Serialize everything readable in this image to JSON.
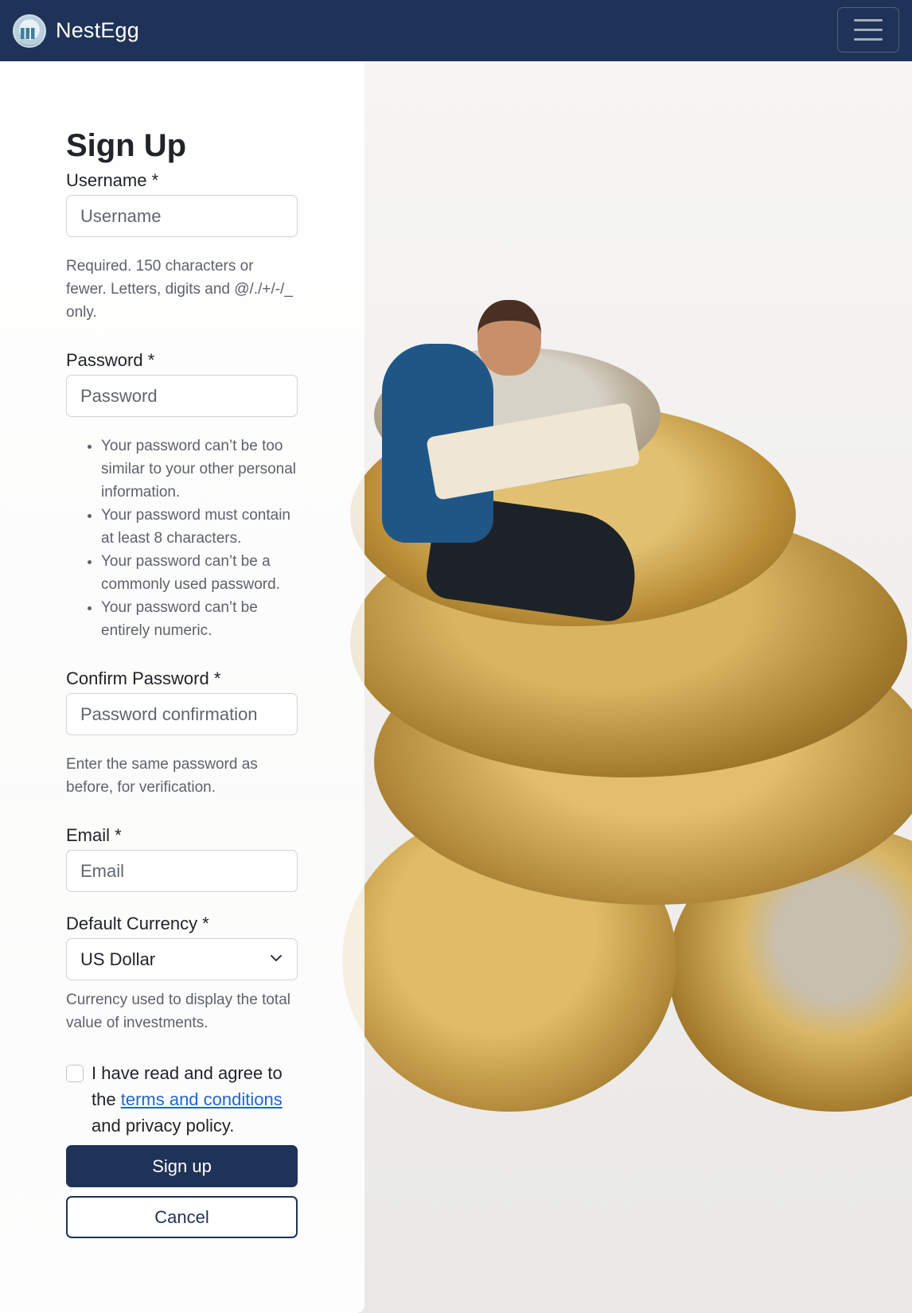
{
  "navbar": {
    "brand_name": "NestEgg",
    "logo_icon": "nest-egg-logo-icon",
    "menu_icon": "hamburger-menu-icon"
  },
  "form": {
    "title": "Sign Up",
    "username": {
      "label": "Username *",
      "placeholder": "Username",
      "help": "Required. 150 characters or fewer. Letters, digits and @/./+/-/_ only."
    },
    "password": {
      "label": "Password *",
      "placeholder": "Password",
      "rules": [
        "Your password can’t be too similar to your other personal information.",
        "Your password must contain at least 8 characters.",
        "Your password can’t be a commonly used password.",
        "Your password can’t be entirely numeric."
      ]
    },
    "confirm_password": {
      "label": "Confirm Password *",
      "placeholder": "Password confirmation",
      "help": "Enter the same password as before, for verification."
    },
    "email": {
      "label": "Email *",
      "placeholder": "Email"
    },
    "currency": {
      "label": "Default Currency *",
      "selected": "US Dollar",
      "help": "Currency used to display the total value of investments."
    },
    "agree": {
      "prefix": "I have read and agree to the",
      "link_text": "terms and conditions",
      "suffix": "and privacy policy."
    },
    "submit_label": "Sign up",
    "cancel_label": "Cancel"
  },
  "colors": {
    "primary": "#1f3358",
    "link": "#1f66d1"
  }
}
